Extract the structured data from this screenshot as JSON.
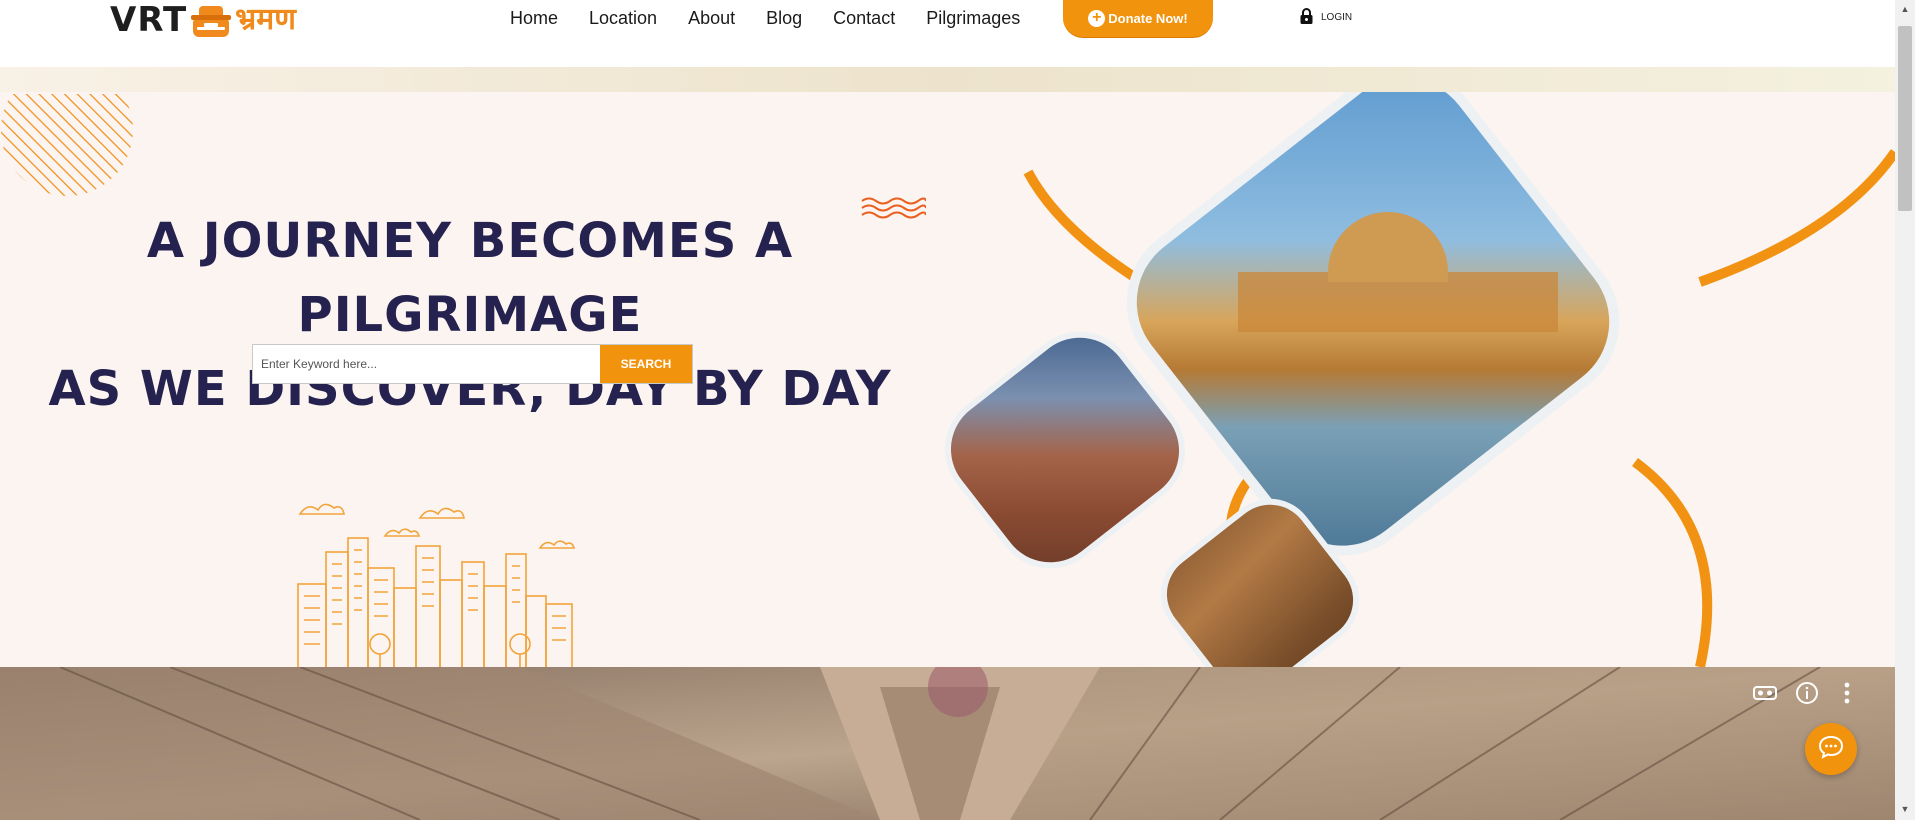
{
  "logo": {
    "text": "VRT",
    "hindi": "भ्रमण"
  },
  "nav": {
    "items": [
      {
        "label": "Home"
      },
      {
        "label": "Location"
      },
      {
        "label": "About"
      },
      {
        "label": "Blog"
      },
      {
        "label": "Contact"
      },
      {
        "label": "Pilgrimages"
      }
    ]
  },
  "donate": {
    "label": "Donate Now!",
    "icon": "plus-circle-icon"
  },
  "login": {
    "label": "LOGIN",
    "icon": "lock-icon"
  },
  "hero": {
    "title_line1": "A JOURNEY BECOMES A PILGRIMAGE",
    "title_line2": "AS WE DISCOVER, DAY BY DAY",
    "search_placeholder": "Enter Keyword here...",
    "search_button": "SEARCH"
  },
  "video": {
    "controls": [
      "vr-headset-icon",
      "info-icon",
      "more-vertical-icon"
    ]
  },
  "chat": {
    "icon": "chat-bubble-icon"
  },
  "colors": {
    "accent": "#f2930d",
    "title": "#25224f",
    "hero_bg": "#fbf4f0"
  }
}
